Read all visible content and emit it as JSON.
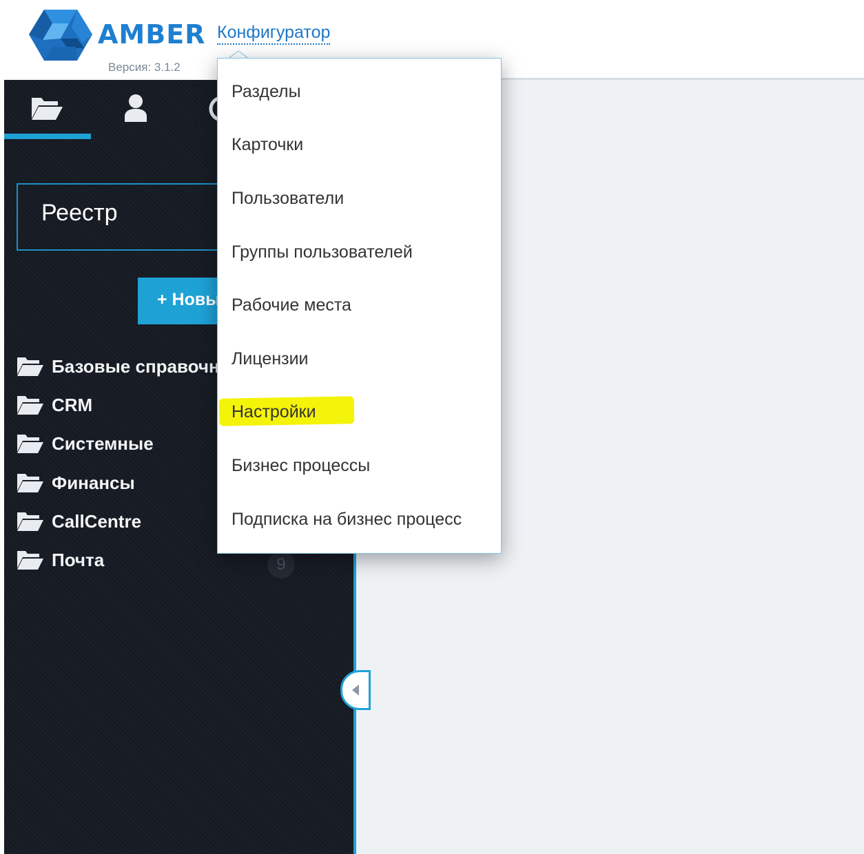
{
  "header": {
    "brand": "AMBER",
    "version": "Версия: 3.1.2",
    "configurator_label": "Конфигуратор"
  },
  "sidebar": {
    "tabs": [
      {
        "icon": "folder-open-icon",
        "active": true
      },
      {
        "icon": "user-icon",
        "active": false
      },
      {
        "icon": "clock-icon",
        "active": false
      }
    ],
    "registry_title": "Реестр",
    "new_button": "+ Новый",
    "folders": [
      {
        "label": "Базовые справочники"
      },
      {
        "label": "CRM"
      },
      {
        "label": "Системные"
      },
      {
        "label": "Финансы"
      },
      {
        "label": "CallCentre"
      },
      {
        "label": "Почта",
        "count": "9"
      }
    ]
  },
  "dropdown": {
    "items": [
      {
        "label": "Разделы"
      },
      {
        "label": "Карточки"
      },
      {
        "label": "Пользователи"
      },
      {
        "label": "Группы пользователей"
      },
      {
        "label": "Рабочие места"
      },
      {
        "label": "Лицензии"
      },
      {
        "label": "Настройки",
        "highlighted": true
      },
      {
        "label": "Бизнес процессы"
      },
      {
        "label": "Подписка на бизнес процесс"
      }
    ],
    "highlight_color": "#f4f30a"
  },
  "colors": {
    "accent": "#1ea2d6",
    "brand": "#1f7fd0",
    "sidebar_bg": "#161a22",
    "content_bg": "#eef2f5"
  }
}
